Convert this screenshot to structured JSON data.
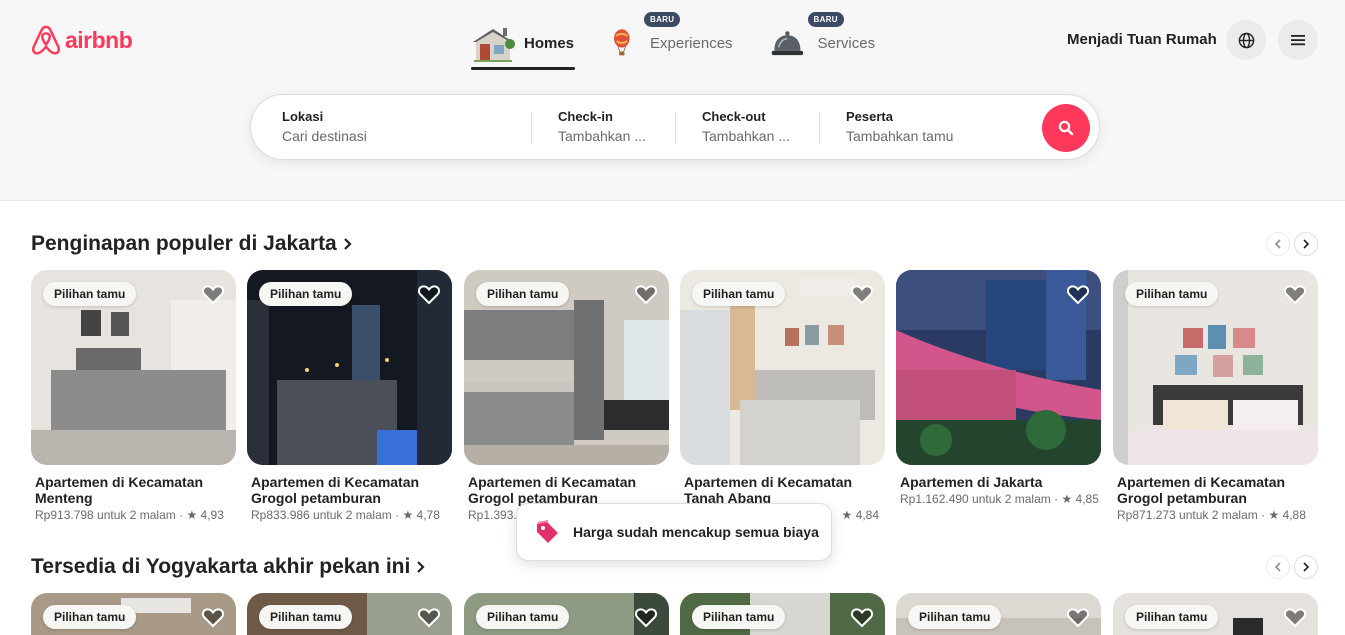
{
  "brand": {
    "name": "airbnb",
    "color": "#ff385c"
  },
  "nav": {
    "tabs": [
      {
        "label": "Homes",
        "icon": "house-icon",
        "active": true
      },
      {
        "label": "Experiences",
        "icon": "hot-air-balloon-icon",
        "badge": "BARU"
      },
      {
        "label": "Services",
        "icon": "service-bell-icon",
        "badge": "BARU"
      }
    ],
    "host_link": "Menjadi Tuan Rumah"
  },
  "search": {
    "location": {
      "title": "Lokasi",
      "placeholder": "Cari destinasi"
    },
    "checkin": {
      "title": "Check-in",
      "placeholder": "Tambahkan ..."
    },
    "checkout": {
      "title": "Check-out",
      "placeholder": "Tambahkan ..."
    },
    "guests": {
      "title": "Peserta",
      "placeholder": "Tambahkan tamu"
    }
  },
  "sections": [
    {
      "title": "Penginapan populer di Jakarta",
      "cards": [
        {
          "badge": "Pilihan tamu",
          "name": "Apartemen di Kecamatan Menteng",
          "price": "Rp913.798 untuk 2 malam",
          "rating": "★ 4,93"
        },
        {
          "badge": "Pilihan tamu",
          "name": "Apartemen di Kecamatan Grogol petamburan",
          "price": "Rp833.986 untuk 2 malam",
          "rating": "★ 4,78"
        },
        {
          "badge": "Pilihan tamu",
          "name": "Apartemen di Kecamatan Grogol petamburan",
          "price": "Rp1.393.8",
          "rating": ""
        },
        {
          "badge": "Pilihan tamu",
          "name": "Apartemen di Kecamatan Tanah Abang",
          "price": "",
          "rating": "★ 4,84"
        },
        {
          "badge": "",
          "name": "Apartemen di Jakarta",
          "price": "Rp1.162.490 untuk 2 malam",
          "rating": "★ 4,85"
        },
        {
          "badge": "Pilihan tamu",
          "name": "Apartemen di Kecamatan Grogol petamburan",
          "price": "Rp871.273 untuk 2 malam",
          "rating": "★ 4,88"
        }
      ]
    },
    {
      "title": "Tersedia di Yogyakarta akhir pekan ini",
      "cards": [
        {
          "badge": "Pilihan tamu"
        },
        {
          "badge": "Pilihan tamu"
        },
        {
          "badge": "Pilihan tamu"
        },
        {
          "badge": "Pilihan tamu"
        },
        {
          "badge": "Pilihan tamu"
        },
        {
          "badge": "Pilihan tamu"
        }
      ]
    }
  ],
  "toast": {
    "message": "Harga sudah mencakup semua biaya",
    "icon": "price-tag-icon"
  }
}
